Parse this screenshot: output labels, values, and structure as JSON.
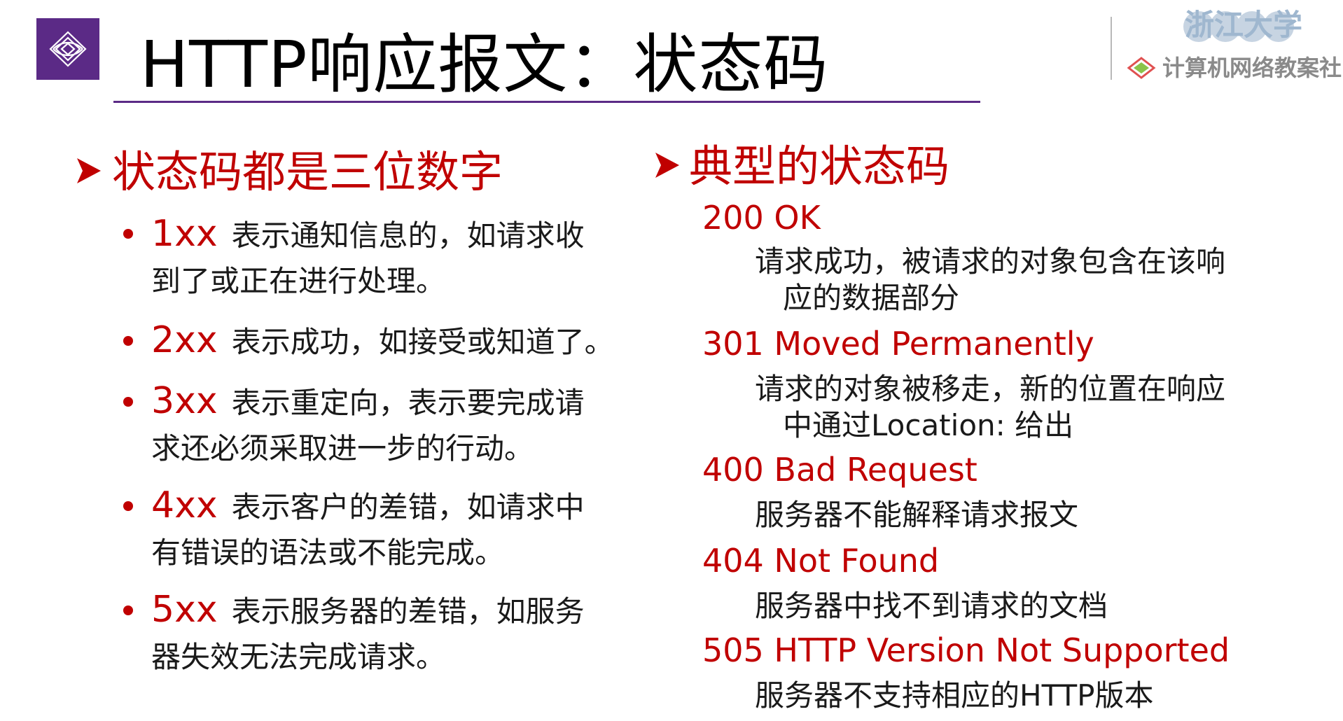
{
  "slide": {
    "title": "HTTP响应报文：状态码",
    "brand": {
      "university": "浙江大学",
      "org": "计算机网络教案社区"
    },
    "left": {
      "heading": "状态码都是三位数字",
      "items": [
        {
          "code": "1xx",
          "line1": "表示通知信息的，如请求收",
          "line2": "到了或正在进行处理。"
        },
        {
          "code": "2xx",
          "line1": "表示成功，如接受或知道了。",
          "line2": ""
        },
        {
          "code": "3xx",
          "line1": "表示重定向，表示要完成请",
          "line2": "求还必须采取进一步的行动。"
        },
        {
          "code": "4xx",
          "line1": "表示客户的差错，如请求中",
          "line2": "有错误的语法或不能完成。"
        },
        {
          "code": "5xx",
          "line1": "表示服务器的差错，如服务",
          "line2": "器失效无法完成请求。"
        }
      ]
    },
    "right": {
      "heading": "典型的状态码",
      "items": [
        {
          "code": "200 OK",
          "line1": "请求成功，被请求的对象包含在该响",
          "line2": "应的数据部分"
        },
        {
          "code": "301 Moved Permanently",
          "line1": "请求的对象被移走，新的位置在响应",
          "line2": "中通过Location: 给出"
        },
        {
          "code": "400 Bad Request",
          "line1": "服务器不能解释请求报文",
          "line2": ""
        },
        {
          "code": "404 Not Found",
          "line1": "服务器中找不到请求的文档",
          "line2": ""
        },
        {
          "code": "505 HTTP Version Not Supported",
          "line1": "服务器不支持相应的HTTP版本",
          "line2": ""
        }
      ]
    },
    "colors": {
      "accent_purple": "#5b2a86",
      "accent_red": "#c00000"
    }
  }
}
